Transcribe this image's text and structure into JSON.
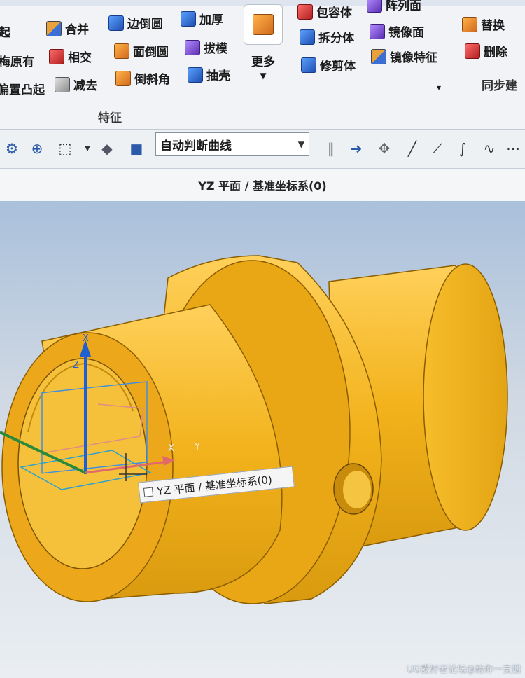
{
  "ribbon": {
    "partial_left": [
      "起",
      "梅原有",
      "偏置凸起"
    ],
    "buttons": [
      {
        "label": "合并"
      },
      {
        "label": "相交"
      },
      {
        "label": "减去"
      },
      {
        "label": "边倒圆"
      },
      {
        "label": "面倒圆"
      },
      {
        "label": "倒斜角"
      },
      {
        "label": "加厚"
      },
      {
        "label": "拔模"
      },
      {
        "label": "抽壳"
      },
      {
        "label": "包容体"
      },
      {
        "label": "拆分体"
      },
      {
        "label": "修剪体"
      },
      {
        "label": "阵列面"
      },
      {
        "label": "镜像面"
      },
      {
        "label": "镜像特征"
      },
      {
        "label": "替换"
      },
      {
        "label": "删除"
      }
    ],
    "more_label": "更多",
    "group_label": "特征",
    "sync_label": "同步建"
  },
  "toolbar": {
    "curve_rule": "自动判断曲线"
  },
  "view_title": "YZ 平面 / 基准坐标系(0)",
  "tooltip": "YZ 平面 / 基准坐标系(0)",
  "axes": {
    "x": "X",
    "y": "Y",
    "z": "Z",
    "top": "X"
  },
  "watermark": "UG爱好者论坛@给你一支烟",
  "colors": {
    "part": "#f2b21b",
    "part_shadow": "#c98b0c",
    "accent": "#1f5fd1"
  }
}
